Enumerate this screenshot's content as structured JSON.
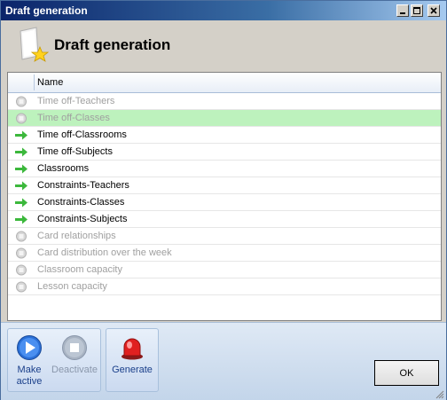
{
  "window": {
    "title": "Draft generation"
  },
  "header": {
    "title": "Draft generation",
    "icon": "document-star-icon"
  },
  "list": {
    "column_header": "Name",
    "items": [
      {
        "label": "Time off-Teachers",
        "status": "disabled",
        "selected": false
      },
      {
        "label": "Time off-Classes",
        "status": "disabled",
        "selected": true
      },
      {
        "label": "Time off-Classrooms",
        "status": "active",
        "selected": false
      },
      {
        "label": "Time off-Subjects",
        "status": "active",
        "selected": false
      },
      {
        "label": "Classrooms",
        "status": "active",
        "selected": false
      },
      {
        "label": "Constraints-Teachers",
        "status": "active",
        "selected": false
      },
      {
        "label": "Constraints-Classes",
        "status": "active",
        "selected": false
      },
      {
        "label": "Constraints-Subjects",
        "status": "active",
        "selected": false
      },
      {
        "label": "Card relationships",
        "status": "disabled",
        "selected": false
      },
      {
        "label": "Card distribution over the week",
        "status": "disabled",
        "selected": false
      },
      {
        "label": "Classroom capacity",
        "status": "disabled",
        "selected": false
      },
      {
        "label": "Lesson capacity",
        "status": "disabled",
        "selected": false
      }
    ]
  },
  "toolbar": {
    "make_active_line1": "Make",
    "make_active_line2": "active",
    "deactivate": "Deactivate",
    "generate": "Generate"
  },
  "ok_label": "OK",
  "colors": {
    "selected_row": "#bdf2bd",
    "active_arrow": "#3cb83c",
    "title_bar": "#0a246a"
  }
}
